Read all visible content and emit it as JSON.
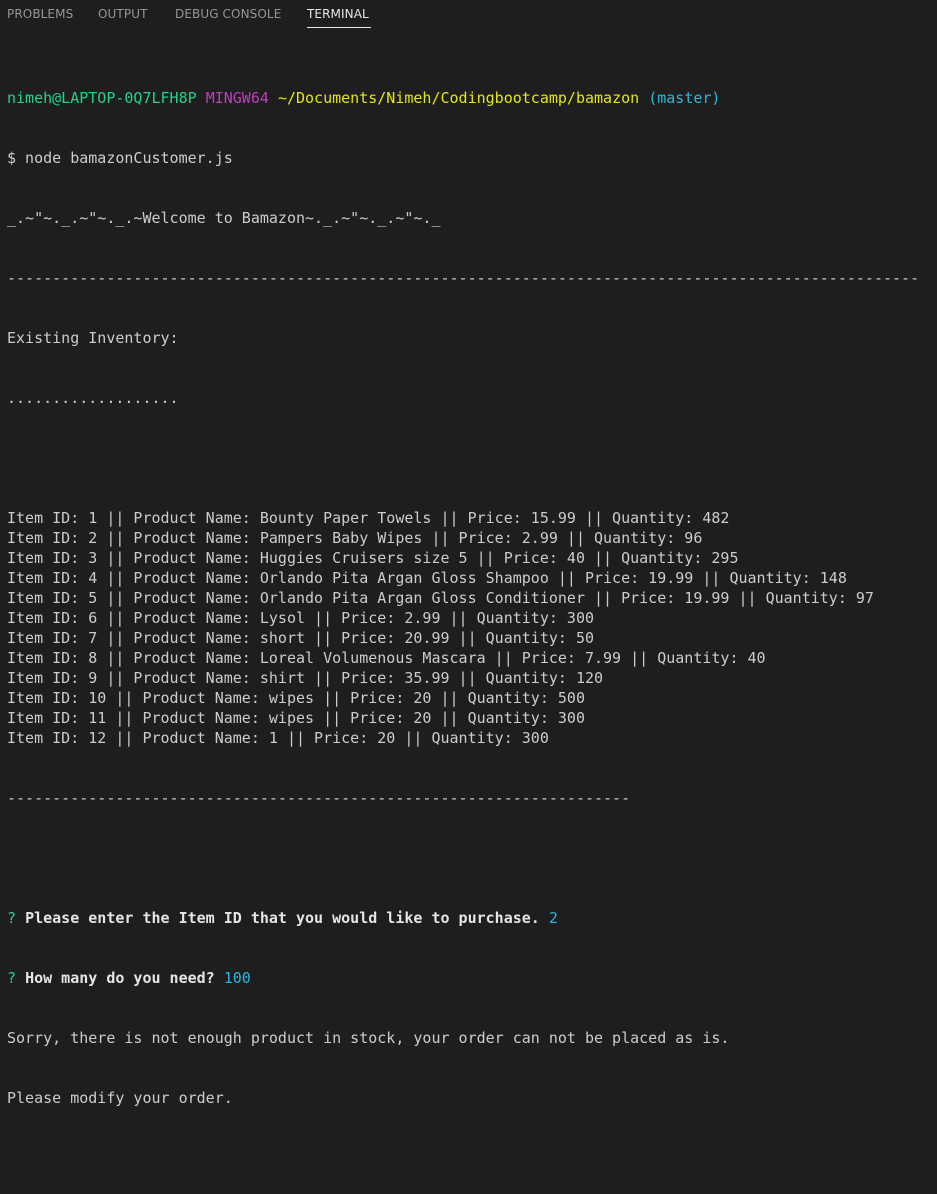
{
  "panel": {
    "tabs": [
      {
        "label": "PROBLEMS"
      },
      {
        "label": "OUTPUT"
      },
      {
        "label": "DEBUG CONSOLE"
      },
      {
        "label": "TERMINAL"
      }
    ],
    "active_tab": "TERMINAL"
  },
  "colors": {
    "background": "#1e1e1e",
    "prompt_user": "#23d18b",
    "prompt_shell": "#bc3fbc",
    "prompt_path": "#e5e510",
    "prompt_branch": "#29b8db",
    "answer": "#29b8db"
  },
  "terminal": {
    "prompt": {
      "user_host": "nimeh@LAPTOP-0Q7LFH8P",
      "shell": "MINGW64",
      "path": "~/Documents/Nimeh/Codingbootcamp/bamazon",
      "branch": "(master)"
    },
    "command_line": "$ node bamazonCustomer.js",
    "welcome": "_.~\"~._.~\"~._.~Welcome to Bamazon~._.~\"~._.~\"~._",
    "divider_long": "-----------------------------------------------------------------------------------------------------",
    "existing_inventory": "Existing Inventory:",
    "dots": "...................",
    "inventory": [
      "Item ID: 1 || Product Name: Bounty Paper Towels || Price: 15.99 || Quantity: 482",
      "Item ID: 2 || Product Name: Pampers Baby Wipes || Price: 2.99 || Quantity: 96",
      "Item ID: 3 || Product Name: Huggies Cruisers size 5 || Price: 40 || Quantity: 295",
      "Item ID: 4 || Product Name: Orlando Pita Argan Gloss Shampoo || Price: 19.99 || Quantity: 148",
      "Item ID: 5 || Product Name: Orlando Pita Argan Gloss Conditioner || Price: 19.99 || Quantity: 97",
      "Item ID: 6 || Product Name: Lysol || Price: 2.99 || Quantity: 300",
      "Item ID: 7 || Product Name: short || Price: 20.99 || Quantity: 50",
      "Item ID: 8 || Product Name: Loreal Volumenous Mascara || Price: 7.99 || Quantity: 40",
      "Item ID: 9 || Product Name: shirt || Price: 35.99 || Quantity: 120",
      "Item ID: 10 || Product Name: wipes || Price: 20 || Quantity: 500",
      "Item ID: 11 || Product Name: wipes || Price: 20 || Quantity: 300",
      "Item ID: 12 || Product Name: 1 || Price: 20 || Quantity: 300"
    ],
    "divider_short": "---------------------------------------------------------------------",
    "question1": {
      "mark": "?",
      "text": "Please enter the Item ID that you would like to purchase.",
      "answer": "2"
    },
    "question2": {
      "mark": "?",
      "text": "How many do you need?",
      "answer": "100"
    },
    "message1": "Sorry, there is not enough product in stock, your order can not be placed as is.",
    "message2": "Please modify your order."
  }
}
